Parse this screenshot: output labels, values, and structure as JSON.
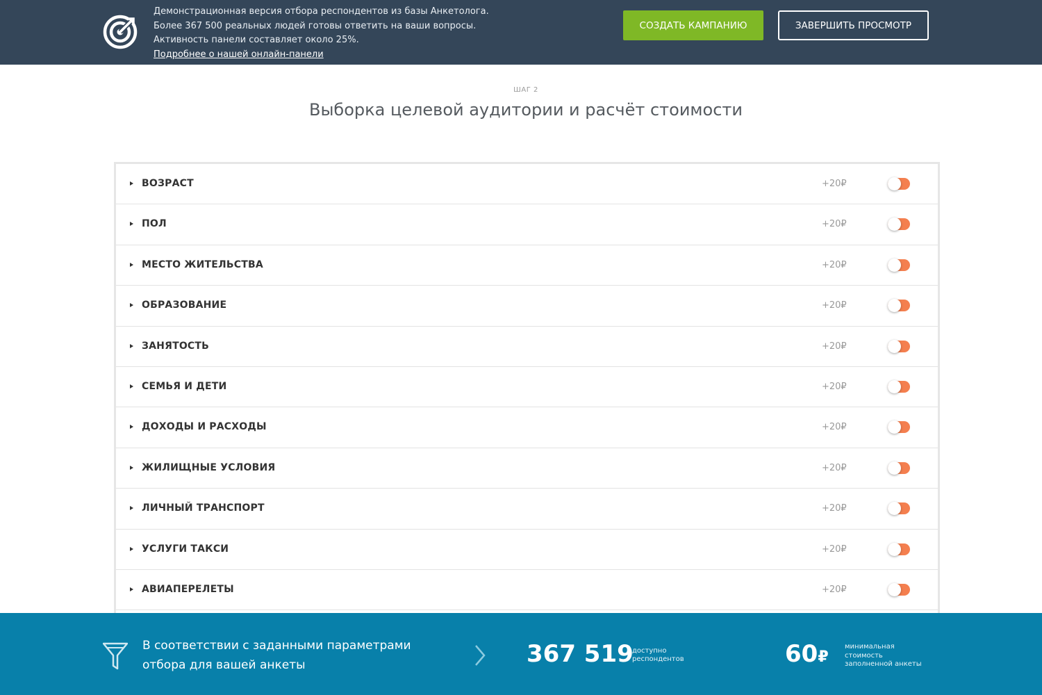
{
  "banner": {
    "lines": [
      "Демонстрационная версия отбора респондентов из базы Анкетолога.",
      "Более 367 500 реальных людей готовы ответить на ваши вопросы.",
      "Активность панели составляет около 25%."
    ],
    "link": "Подробнее о нашей онлайн-панели",
    "create_button": "СОЗДАТЬ КАМПАНИЮ",
    "finish_button": "ЗАВЕРШИТЬ ПРОСМОТР",
    "logo_icon": "target-logo-icon"
  },
  "heading": {
    "step": "ШАГ 2",
    "title": "Выборка целевой аудитории и расчёт стоимости"
  },
  "filters": [
    {
      "label": "ВОЗРАСТ",
      "price": "+20₽",
      "enabled": false
    },
    {
      "label": "ПОЛ",
      "price": "+20₽",
      "enabled": false
    },
    {
      "label": "МЕСТО ЖИТЕЛЬСТВА",
      "price": "+20₽",
      "enabled": false
    },
    {
      "label": "ОБРАЗОВАНИЕ",
      "price": "+20₽",
      "enabled": false
    },
    {
      "label": "ЗАНЯТОСТЬ",
      "price": "+20₽",
      "enabled": false
    },
    {
      "label": "СЕМЬЯ И ДЕТИ",
      "price": "+20₽",
      "enabled": false
    },
    {
      "label": "ДОХОДЫ И РАСХОДЫ",
      "price": "+20₽",
      "enabled": false
    },
    {
      "label": "ЖИЛИЩНЫЕ УСЛОВИЯ",
      "price": "+20₽",
      "enabled": false
    },
    {
      "label": "ЛИЧНЫЙ ТРАНСПОРТ",
      "price": "+20₽",
      "enabled": false
    },
    {
      "label": "УСЛУГИ ТАКСИ",
      "price": "+20₽",
      "enabled": false
    },
    {
      "label": "АВИАПЕРЕЛЕТЫ",
      "price": "+20₽",
      "enabled": false
    },
    {
      "label": "",
      "price": "",
      "enabled": false
    }
  ],
  "summary": {
    "text_lines": [
      "В соответствии с заданными параметрами",
      "отбора для вашей анкеты"
    ],
    "count": "367 519",
    "count_caption": [
      "доступно",
      "респондентов"
    ],
    "cost": "60",
    "currency": "₽",
    "cost_caption": [
      "минимальная",
      "стоимость",
      "заполненной анкеты"
    ],
    "funnel_icon": "funnel-icon",
    "chevron_icon": "chevron-right-icon"
  },
  "colors": {
    "banner_bg": "#344659",
    "create_button": "#7fb826",
    "toggle_track": "#f47f4f",
    "summary_bg": "#0880aa"
  }
}
